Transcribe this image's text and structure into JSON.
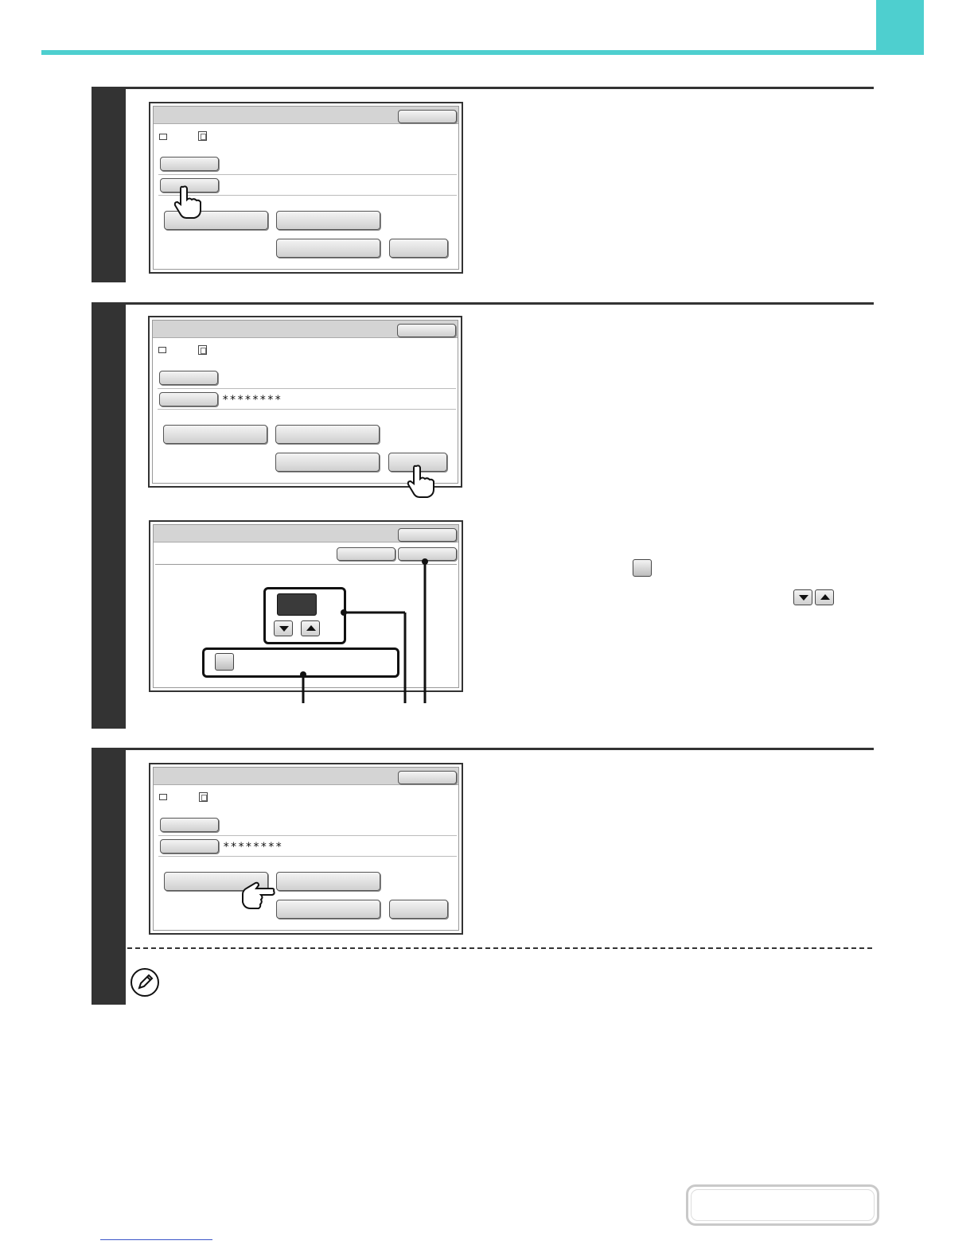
{
  "page": {
    "accent_color": "#4ecfcf",
    "step_bar_color": "#333333"
  },
  "step_screens": [
    {
      "masked_password": ""
    },
    {
      "masked_password": "********"
    },
    {
      "masked_password": ""
    },
    {
      "masked_password": "********"
    }
  ],
  "icons": {
    "folder": "folder-icon",
    "document": "document-icon",
    "hand_pointer": "hand-pointer-icon",
    "note": "pencil-note-icon",
    "arrow_down": "arrow-down-icon",
    "arrow_up": "arrow-up-icon",
    "checkbox": "checkbox-icon"
  }
}
